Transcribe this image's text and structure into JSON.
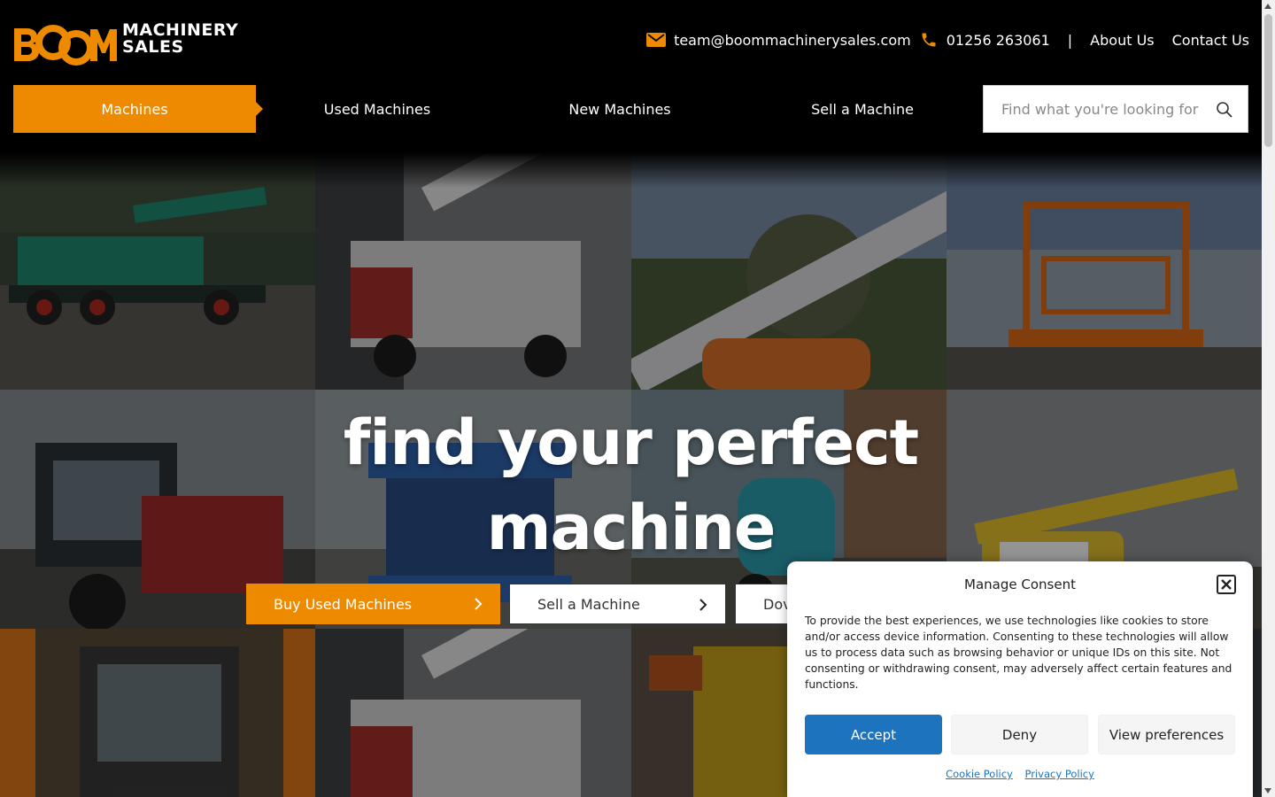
{
  "brand": {
    "logo_word": "BOOM",
    "logo_tagline_line1": "MACHINERY",
    "logo_tagline_line2": "SALES",
    "accent_color": "#ee8a00"
  },
  "header": {
    "email": "team@boommachinerysales.com",
    "phone": "01256 263061",
    "separator": "|",
    "about_label": "About Us",
    "contact_label": "Contact Us",
    "email_icon": "envelope-icon",
    "phone_icon": "phone-icon"
  },
  "nav": {
    "items": [
      {
        "label": "Machines",
        "active": true
      },
      {
        "label": "Used Machines",
        "active": false
      },
      {
        "label": "New Machines",
        "active": false
      },
      {
        "label": "Sell a Machine",
        "active": false
      }
    ],
    "search_placeholder": "Find what you're looking for",
    "search_icon": "search-icon"
  },
  "hero": {
    "headline_line1": "find your perfect",
    "headline_line2": "machine",
    "cta_buy": "Buy Used Machines",
    "cta_sell": "Sell a Machine",
    "cta_third": "Dov"
  },
  "consent": {
    "title": "Manage Consent",
    "body": "To provide the best experiences, we use technologies like cookies to store and/or access device information. Consenting to these technologies will allow us to process data such as browsing behavior or unique IDs on this site. Not consenting or withdrawing consent, may adversely affect certain features and functions.",
    "accept_label": "Accept",
    "deny_label": "Deny",
    "preferences_label": "View preferences",
    "cookie_policy_label": "Cookie Policy",
    "privacy_policy_label": "Privacy Policy",
    "accept_color": "#1e73be"
  }
}
